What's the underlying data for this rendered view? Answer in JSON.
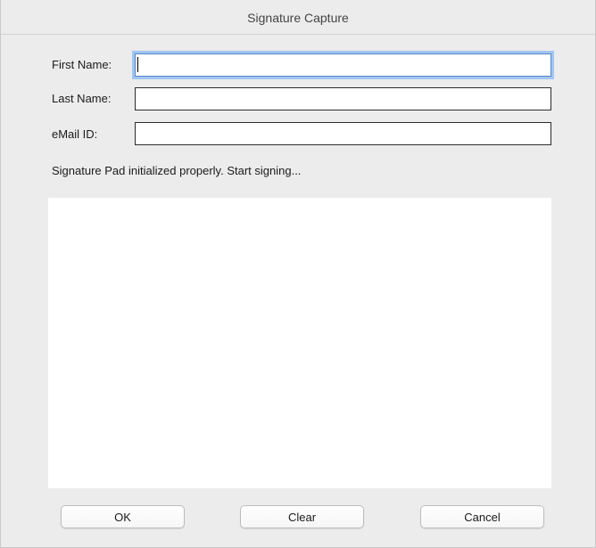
{
  "window": {
    "title": "Signature Capture"
  },
  "form": {
    "first_name": {
      "label": "First Name:",
      "value": ""
    },
    "last_name": {
      "label": "Last Name:",
      "value": ""
    },
    "email": {
      "label": "eMail ID:",
      "value": ""
    }
  },
  "status_text": "Signature Pad initialized properly. Start signing...",
  "buttons": {
    "ok_label": "OK",
    "clear_label": "Clear",
    "cancel_label": "Cancel"
  },
  "colors": {
    "window_bg": "#ececec",
    "focus_ring": "#9fc6f3",
    "pad_bg": "#ffffff"
  }
}
